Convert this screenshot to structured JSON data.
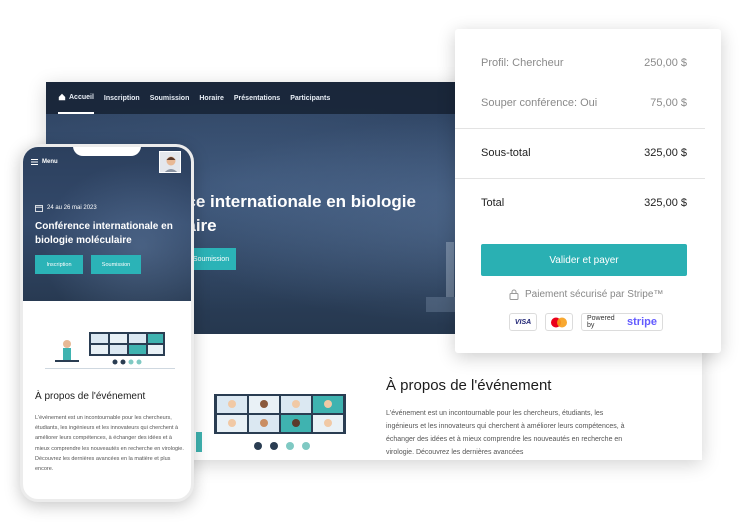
{
  "desktop": {
    "nav": [
      {
        "label": "Accueil",
        "active": true
      },
      {
        "label": "Inscription"
      },
      {
        "label": "Soumission"
      },
      {
        "label": "Horaire"
      },
      {
        "label": "Présentations"
      },
      {
        "label": "Participants"
      }
    ],
    "hero_title": "nce internationale en biologie\nnaire",
    "hero_button": "Soumission",
    "about_title": "À propos de l'événement",
    "about_text": "L'événement est un incontournable pour les chercheurs, étudiants, les ingénieurs et les innovateurs qui cherchent à améliorer leurs compétences, à échanger des idées et à mieux comprendre les nouveautés en recherche en virologie. Découvrez les dernières avancées"
  },
  "payment": {
    "rows": [
      {
        "label": "Profil: Chercheur",
        "amount": "250,00 $"
      },
      {
        "label": "Souper conférence: Oui",
        "amount": "75,00 $"
      }
    ],
    "subtotal": {
      "label": "Sous-total",
      "amount": "325,00 $"
    },
    "total": {
      "label": "Total",
      "amount": "325,00 $"
    },
    "pay_button": "Valider et payer",
    "secure_text": "Paiement sécurisé par Stripe™",
    "badges": {
      "visa": "VISA",
      "powered_by": "Powered by",
      "stripe": "stripe"
    }
  },
  "mobile": {
    "menu_label": "Menu",
    "date": "24 au 26 mai 2023",
    "title": "Conférence internationale en biologie moléculaire",
    "buttons": [
      "Inscription",
      "Soumission"
    ],
    "about_title": "À propos de l'événement",
    "about_text": "L'événement est un incontournable pour les chercheurs, étudiants, les ingénieurs et les innovateurs qui cherchent à améliorer leurs compétences, à échanger des idées et à mieux comprendre les nouveautés en recherche en virologie. Découvrez les dernières avancées en la matière et plus encore."
  },
  "colors": {
    "accent": "#2ab0b3",
    "hero": "#2b3f5c",
    "stripe": "#635bff"
  }
}
